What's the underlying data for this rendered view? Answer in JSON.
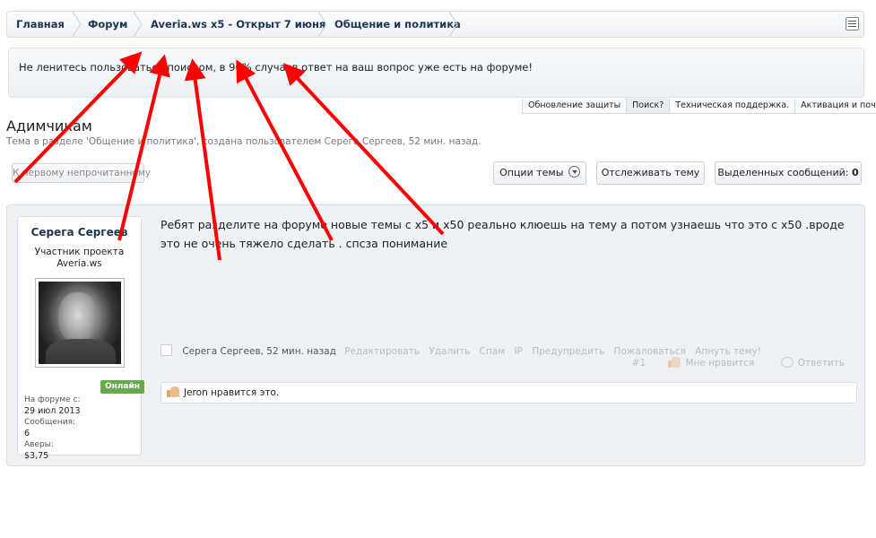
{
  "breadcrumb": {
    "items": [
      {
        "label": "Главная"
      },
      {
        "label": "Форум"
      },
      {
        "label": "Averia.ws x5 - Открыт 7 июня"
      },
      {
        "label": "Общение и политика"
      }
    ]
  },
  "notice": {
    "text": "Не ленитесь пользоваться поиском, в 90% случаев ответ на ваш вопрос уже есть на форуме!"
  },
  "quick_tabs": [
    {
      "label": "Обновление защиты"
    },
    {
      "label": "Поиск?"
    },
    {
      "label": "Техническая поддержка."
    },
    {
      "label": "Активация и почта!"
    }
  ],
  "thread": {
    "title": "Адимчикам",
    "meta": "Тема в разделе 'Общение и политика', создана пользователем Серега Сергеев, 52 мин. назад."
  },
  "buttons": {
    "first_unread": "К первому непрочитанному",
    "thread_options": "Опции темы",
    "follow": "Отслеживать тему",
    "selected_label": "Выделенных сообщений:",
    "selected_count": "0"
  },
  "post": {
    "author": "Серега Сергеев",
    "rank_line1": "Участник проекта",
    "rank_line2": "Averia.ws",
    "online": "Онлайн",
    "stats": {
      "joined_label": "На форуме с:",
      "joined_value": "29 июл 2013",
      "messages_label": "Сообщения:",
      "messages_value": "6",
      "avers_label": "Аверы:",
      "avers_value": "$3,75"
    },
    "text": "Ребят разделите на форуме новые темы с x5 и x50 реально клюешь на тему а потом узнаешь что это с x50 .вроде это не очень тяжело сделать . спсза понимание",
    "actions": {
      "author_time": "Серега Сергеев, 52 мин. назад",
      "edit": "Редактировать",
      "delete": "Удалить",
      "spam": "Спам",
      "ip": "IP",
      "warn": "Предупредить",
      "report": "Пожаловаться",
      "bump": "Апнуть тему!"
    },
    "number": "#1",
    "like": "Мне нравится",
    "reply": "Ответить",
    "likes_text": "Jeron нравится это."
  },
  "annotation_color": "#ff0000"
}
